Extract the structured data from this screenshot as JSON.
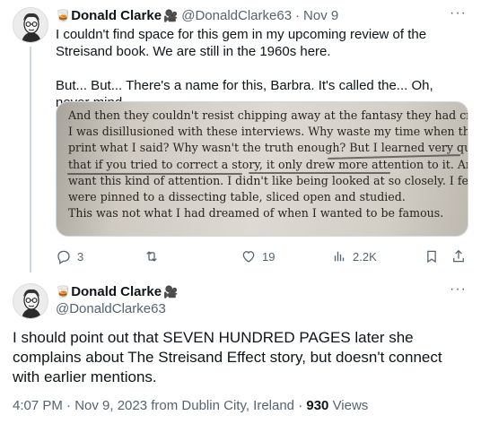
{
  "tweet1": {
    "author_name": "Donald Clarke",
    "author_handle": "@DonaldClarke63",
    "separator": "·",
    "date": "Nov 9",
    "text_line1": "I couldn't find space for this gem in my upcoming review of the Streisand book. We are still in the 1960s here.",
    "text_line2": "But... But... There's a name for this, Barbra. It's called the... Oh, never mind.",
    "photo_lines": [
      "And then they couldn't resist chipping away at the fantasy they had created.",
      "I was disillusioned with these interviews. Why waste my time when they didn't",
      "print what I said? Why wasn't the truth enough? But I learned very quickly",
      "that if you tried to correct a story, it only drew more attention to it. And I didn't",
      "want this kind of attention. I didn't like being looked at so closely. I felt as if I",
      "were pinned to a dissecting table, sliced open and studied.",
      "This was not what I had dreamed of when I wanted to be famous."
    ],
    "replies": "3",
    "reposts": "",
    "likes": "19",
    "views": "2.2K"
  },
  "tweet2": {
    "author_name": "Donald Clarke",
    "author_handle": "@DonaldClarke63",
    "text": "I should point out that SEVEN HUNDRED PAGES later she complains about The Streisand Effect story, but doesn't connect with earlier mentions.",
    "meta_prefix": "4:07 PM · Nov 9, 2023 from Dublin City, Ireland · ",
    "views_count": "930",
    "views_label": "Views"
  },
  "icons": {
    "more": "more-icon",
    "reply": "reply-icon",
    "repost": "repost-icon",
    "like": "heart-icon",
    "views": "views-icon",
    "bookmark": "bookmark-icon",
    "share": "share-icon",
    "badge": "movie-camera-icon",
    "emoji": "glass-emoji"
  },
  "colors": {
    "text": "#0f1419",
    "muted": "#536471",
    "border": "#cfd9de"
  }
}
